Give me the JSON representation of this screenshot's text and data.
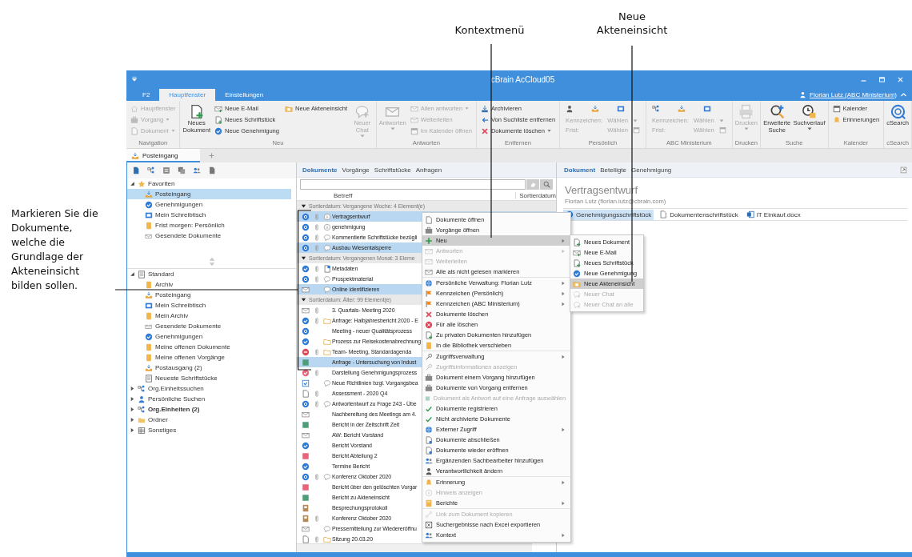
{
  "callouts": [
    {
      "text": "Kontextmenü"
    },
    {
      "text": "Neue Akteneinsicht"
    }
  ],
  "instruction": "Markieren Sie die Dokumente, welche die Grundlage der Akteneinsicht bilden sollen.",
  "window": {
    "title": "cBrain AcCloud05",
    "user": "Florian Lutz (ABC Ministerium)"
  },
  "ribbon_tabs": [
    {
      "label": "F2",
      "selected": false
    },
    {
      "label": "Hauptfenster",
      "selected": true
    },
    {
      "label": "Einstellungen",
      "selected": false
    }
  ],
  "ribbon_groups": [
    {
      "label": "Navigation",
      "columns": [
        [
          {
            "kind": "small",
            "label": "Hauptfenster",
            "disabled": true,
            "dropdown": false
          },
          {
            "kind": "small",
            "label": "Vorgang",
            "disabled": true,
            "dropdown": true
          },
          {
            "kind": "small",
            "label": "Dokument",
            "disabled": true,
            "dropdown": true
          }
        ]
      ]
    },
    {
      "label": "Neu",
      "columns": [
        [
          {
            "kind": "large",
            "label": "Neues Dokument",
            "disabled": false,
            "dropdown": false
          }
        ],
        [
          {
            "kind": "small",
            "label": "Neue E-Mail",
            "disabled": false,
            "dropdown": false
          },
          {
            "kind": "small",
            "label": "Neues Schriftstück",
            "disabled": false,
            "dropdown": false
          },
          {
            "kind": "small",
            "label": "Neue Genehmigung",
            "disabled": false,
            "dropdown": false
          }
        ],
        [
          {
            "kind": "small",
            "label": "Neue Akteneinsicht",
            "disabled": false,
            "dropdown": false
          }
        ],
        [
          {
            "kind": "large",
            "label": "Neuer Chat",
            "disabled": true,
            "dropdown": true
          }
        ]
      ]
    },
    {
      "label": "Antworten",
      "columns": [
        [
          {
            "kind": "large",
            "label": "Antworten",
            "disabled": true,
            "dropdown": true
          }
        ],
        [
          {
            "kind": "small",
            "label": "Allen antworten",
            "disabled": true,
            "dropdown": true
          },
          {
            "kind": "small",
            "label": "Weiterleiten",
            "disabled": true,
            "dropdown": false
          },
          {
            "kind": "small",
            "label": "Im Kalender öffnen",
            "disabled": true,
            "dropdown": false
          }
        ]
      ]
    },
    {
      "label": "Entfernen",
      "columns": [
        [
          {
            "kind": "small",
            "label": "Archivieren",
            "disabled": false,
            "dropdown": false
          },
          {
            "kind": "small",
            "label": "Von Suchliste entfernen",
            "disabled": false,
            "dropdown": false
          },
          {
            "kind": "small",
            "label": "Dokumente löschen",
            "disabled": false,
            "dropdown": true
          }
        ]
      ]
    },
    {
      "label": "Persönlich",
      "columns": [
        [
          {
            "kind": "field",
            "label": "Kennzeichen:",
            "value": "Wählen",
            "disabled": true,
            "dropdown": true
          },
          {
            "kind": "field",
            "label": "Frist:",
            "value": "Wählen",
            "disabled": true,
            "dropdown": false
          }
        ]
      ]
    },
    {
      "label": "ABC Ministerium",
      "columns": [
        [
          {
            "kind": "field",
            "label": "Kennzeichen:",
            "value": "Wählen",
            "disabled": true,
            "dropdown": true
          },
          {
            "kind": "field",
            "label": "Frist:",
            "value": "Wählen",
            "disabled": true,
            "dropdown": false
          }
        ]
      ]
    },
    {
      "label": "Drucken",
      "columns": [
        [
          {
            "kind": "large",
            "label": "Drucken",
            "disabled": true,
            "dropdown": true
          }
        ]
      ]
    },
    {
      "label": "Suche",
      "columns": [
        [
          {
            "kind": "large",
            "label": "Erweiterte Suche",
            "disabled": false,
            "dropdown": false
          }
        ],
        [
          {
            "kind": "large",
            "label": "Suchverlauf",
            "disabled": false,
            "dropdown": true
          }
        ]
      ]
    },
    {
      "label": "Kalender",
      "columns": [
        [
          {
            "kind": "small",
            "label": "Kalender",
            "disabled": false,
            "dropdown": false
          },
          {
            "kind": "small",
            "label": "Erinnerungen",
            "disabled": false,
            "dropdown": false
          }
        ]
      ]
    },
    {
      "label": "cSearch",
      "columns": [
        [
          {
            "kind": "large",
            "label": "cSearch",
            "disabled": false,
            "dropdown": false
          }
        ]
      ]
    }
  ],
  "document_tabs": [
    {
      "label": "Posteingang",
      "selected": true
    }
  ],
  "sidebar": {
    "favorites": {
      "label": "Favoriten",
      "expanded": true,
      "children": [
        {
          "label": "Posteingang",
          "selected": true
        },
        {
          "label": "Genehmigungen",
          "selected": false
        },
        {
          "label": "Mein Schreibtisch",
          "selected": false
        },
        {
          "label": "Frist morgen: Persönlich",
          "selected": false
        },
        {
          "label": "Gesendete Dokumente",
          "selected": false
        }
      ]
    },
    "tree": [
      {
        "label": "Standard",
        "expanded": true,
        "unread": false,
        "children": [
          {
            "label": "Archiv",
            "selected": false
          },
          {
            "label": "Posteingang",
            "selected": false
          },
          {
            "label": "Mein Schreibtisch",
            "selected": false
          },
          {
            "label": "Mein Archiv",
            "selected": false
          },
          {
            "label": "Gesendete Dokumente",
            "selected": false
          },
          {
            "label": "Genehmigungen",
            "selected": false
          },
          {
            "label": "Meine offenen Dokumente",
            "selected": false
          },
          {
            "label": "Meine offenen Vorgänge",
            "selected": false
          },
          {
            "label": "Postausgang (2)",
            "selected": false
          },
          {
            "label": "Neueste Schriftstücke",
            "selected": false
          }
        ]
      },
      {
        "label": "Org.Einheitssuchen",
        "expanded": false,
        "unread": false
      },
      {
        "label": "Persönliche Suchen",
        "expanded": false,
        "unread": false
      },
      {
        "label": "Org.Einheiten (2)",
        "expanded": false,
        "unread": true
      },
      {
        "label": "Ordner",
        "expanded": false,
        "unread": false
      },
      {
        "label": "Sonstiges",
        "expanded": false,
        "unread": false
      }
    ]
  },
  "document_list": {
    "tabs": [
      {
        "label": "Dokumente",
        "selected": true
      },
      {
        "label": "Vorgänge",
        "selected": false
      },
      {
        "label": "Schriftstücke",
        "selected": false
      },
      {
        "label": "Anfragen",
        "selected": false
      }
    ],
    "columns": [
      "Betreff",
      "Sortierdatum"
    ],
    "groups": [
      {
        "label": "Sortierdatum: Vergangene Woche: 4 Element(e)",
        "expanded": true,
        "rows": [
          {
            "subject": "Vertragsentwurf",
            "kind": "badge",
            "attachment": true,
            "marker": {
              "kind": "info"
            },
            "selected": true
          },
          {
            "subject": "genehmigung",
            "kind": "badge",
            "attachment": true,
            "marker": {
              "kind": "info"
            },
            "selected": false
          },
          {
            "subject": "Kommentierte Schriftstücke bezügli",
            "kind": "badge",
            "attachment": true,
            "marker": {
              "kind": "comment"
            },
            "selected": false
          },
          {
            "subject": "Ausbau Wiesentalsperre",
            "kind": "badge",
            "attachment": true,
            "marker": {
              "kind": "comment"
            },
            "selected": true
          }
        ]
      },
      {
        "label": "Sortierdatum: Vergangenen Monat: 3 Eleme",
        "expanded": true,
        "rows": [
          {
            "subject": "Metadaten",
            "kind": "check",
            "attachment": true,
            "marker": {
              "kind": "meta"
            },
            "selected": false
          },
          {
            "subject": "Prospektmaterial",
            "kind": "badge",
            "attachment": true,
            "marker": {
              "kind": "comment"
            },
            "selected": false
          },
          {
            "subject": "Online identifizieren",
            "kind": "mail",
            "attachment": false,
            "marker": {
              "kind": "comment"
            },
            "selected": true
          }
        ]
      },
      {
        "label": "Sortierdatum: Älter: 99 Element(e)",
        "expanded": true,
        "rows": [
          {
            "subject": "3. Quartals- Meeting 2020",
            "kind": "mail",
            "attachment": true,
            "selected": false
          },
          {
            "subject": "Anfrage: Halbjahresbericht 2020 - E",
            "kind": "check",
            "attachment": true,
            "marker": {
              "kind": "folder"
            },
            "selected": false
          },
          {
            "subject": "Meeting - neuer Qualitätsprozess",
            "kind": "badge",
            "attachment": false,
            "selected": false
          },
          {
            "subject": "Prozess zur Reisekostenabrechnung",
            "kind": "check",
            "attachment": false,
            "marker": {
              "kind": "folder"
            },
            "selected": false
          },
          {
            "subject": "Team- Meeting, Standardagenda",
            "kind": "stop",
            "attachment": true,
            "marker": {
              "kind": "folder"
            },
            "selected": false
          },
          {
            "subject": "Anfrage - Untersuchung von Indust",
            "kind": "green",
            "attachment": false,
            "selected": true
          },
          {
            "subject": "Darstellung Genehmigungsprozess",
            "kind": "redcheck",
            "attachment": true,
            "selected": false
          },
          {
            "subject": "Neue Richtlinien bzgl. Vorgangsbea",
            "kind": "checkbox",
            "attachment": false,
            "marker": {
              "kind": "comment"
            },
            "selected": false
          },
          {
            "subject": "Assessment - 2020 Q4",
            "kind": "doc",
            "attachment": true,
            "selected": false
          },
          {
            "subject": "Antwortentwurf zu Frage 243 - Übe",
            "kind": "badge",
            "attachment": true,
            "marker": {
              "kind": "comment"
            },
            "selected": false
          },
          {
            "subject": "Nachbereitung des Meetings am 4.",
            "kind": "mail",
            "attachment": false,
            "selected": false
          },
          {
            "subject": "Bericht in der Zeitschrift Zeit",
            "kind": "green",
            "attachment": false,
            "selected": false
          },
          {
            "subject": "AW: Bericht Vorstand",
            "kind": "mail",
            "attachment": false,
            "selected": false
          },
          {
            "subject": "Bericht Vorstand",
            "kind": "check",
            "attachment": false,
            "selected": false
          },
          {
            "subject": "Bericht Abteilung 2",
            "kind": "red",
            "attachment": false,
            "selected": false
          },
          {
            "subject": "Termine Bericht",
            "kind": "check",
            "attachment": false,
            "selected": false
          },
          {
            "subject": "Konferenz Oktober 2020",
            "kind": "badge",
            "attachment": true,
            "marker": {
              "kind": "comment"
            },
            "selected": false
          },
          {
            "subject": "Bericht über den gelöschten Vorgar",
            "kind": "red",
            "attachment": false,
            "selected": false
          },
          {
            "subject": "Bericht zu Akteneinsicht",
            "kind": "green",
            "attachment": false,
            "selected": false
          },
          {
            "subject": "Besprechungsprotokoll",
            "kind": "brown",
            "attachment": false,
            "selected": false
          },
          {
            "subject": "Konferenz Oktober 2020",
            "kind": "brown",
            "attachment": true,
            "selected": false
          },
          {
            "subject": "Pressemitteilung zur Wiedereröffnu",
            "kind": "mail",
            "attachment": false,
            "marker": {
              "kind": "comment"
            },
            "selected": false
          },
          {
            "subject": "Sitzung 20.03.20",
            "kind": "doc",
            "attachment": true,
            "marker": {
              "kind": "folder"
            },
            "selected": false
          }
        ]
      }
    ]
  },
  "context_menu": {
    "sections": [
      [
        {
          "label": "Dokumente öffnen",
          "disabled": false,
          "submenu": false,
          "selected": false
        },
        {
          "label": "Vorgänge öffnen",
          "disabled": false,
          "submenu": false,
          "selected": false
        },
        {
          "label": "Neu",
          "disabled": false,
          "submenu": true,
          "selected": true
        },
        {
          "label": "Antworten",
          "disabled": true,
          "submenu": true,
          "selected": false
        },
        {
          "label": "Weiterleiten",
          "disabled": true,
          "submenu": false,
          "selected": false
        },
        {
          "label": "Alle als nicht gelesen markieren",
          "disabled": false,
          "submenu": false,
          "selected": false
        }
      ],
      [
        {
          "label": "Persönliche Verwaltung: Florian Lutz",
          "disabled": false,
          "submenu": true,
          "selected": false
        },
        {
          "label": "Kennzeichen (Persönlich)",
          "disabled": false,
          "submenu": true,
          "selected": false
        },
        {
          "label": "Kennzeichen (ABC Ministerium)",
          "disabled": false,
          "submenu": true,
          "selected": false
        },
        {
          "label": "Dokumente löschen",
          "disabled": false,
          "submenu": false,
          "selected": false
        },
        {
          "label": "Für alle löschen",
          "disabled": false,
          "submenu": false,
          "selected": false
        },
        {
          "label": "Zu privaten Dokumenten hinzufügen",
          "disabled": false,
          "submenu": false,
          "selected": false
        },
        {
          "label": "In die Bibliothek verschieben",
          "disabled": false,
          "submenu": false,
          "selected": false
        }
      ],
      [
        {
          "label": "Zugriffsverwaltung",
          "disabled": false,
          "submenu": true,
          "selected": false
        },
        {
          "label": "Zugriffsinformationen anzeigen",
          "disabled": true,
          "submenu": false,
          "selected": false
        },
        {
          "label": "Dokument einem Vorgang hinzufügen",
          "disabled": false,
          "submenu": false,
          "selected": false
        },
        {
          "label": "Dokumente von Vorgang entfernen",
          "disabled": false,
          "submenu": false,
          "selected": false
        },
        {
          "label": "Dokument als Antwort auf eine Anfrage auswählen",
          "disabled": true,
          "submenu": false,
          "selected": false
        },
        {
          "label": "Dokumente registrieren",
          "disabled": false,
          "submenu": false,
          "selected": false
        },
        {
          "label": "Nicht archivierte Dokumente",
          "disabled": false,
          "submenu": false,
          "selected": false
        },
        {
          "label": "Externer Zugriff",
          "disabled": false,
          "submenu": true,
          "selected": false
        },
        {
          "label": "Dokumente abschließen",
          "disabled": false,
          "submenu": false,
          "selected": false
        },
        {
          "label": "Dokumente wieder eröffnen",
          "disabled": false,
          "submenu": false,
          "selected": false
        },
        {
          "label": "Ergänzenden Sachbearbeiter hinzufügen",
          "disabled": false,
          "submenu": false,
          "selected": false
        },
        {
          "label": "Verantwortlichkeit ändern",
          "disabled": false,
          "submenu": false,
          "selected": false
        }
      ],
      [
        {
          "label": "Erinnerung",
          "disabled": false,
          "submenu": true,
          "selected": false
        },
        {
          "label": "Hinweis anzeigen",
          "disabled": true,
          "submenu": false,
          "selected": false
        },
        {
          "label": "Berichte",
          "disabled": false,
          "submenu": true,
          "selected": false
        }
      ],
      [
        {
          "label": "Link zum Dokument kopieren",
          "disabled": true,
          "submenu": false,
          "selected": false
        },
        {
          "label": "Suchergebnisse nach Excel exportieren",
          "disabled": false,
          "submenu": false,
          "selected": false
        },
        {
          "label": "Kontext",
          "disabled": false,
          "submenu": true,
          "selected": false
        }
      ]
    ]
  },
  "submenu": {
    "items": [
      {
        "label": "Neues Dokument",
        "disabled": false,
        "selected": false
      },
      {
        "label": "Neue E-Mail",
        "disabled": false,
        "selected": false
      },
      {
        "label": "Neues Schriftstück",
        "disabled": false,
        "selected": false
      },
      {
        "label": "Neue Genehmigung",
        "disabled": false,
        "selected": false
      },
      {
        "label": "Neue Akteneinsicht",
        "disabled": false,
        "selected": true
      },
      {
        "label": "Neuer Chat",
        "disabled": true,
        "selected": false
      },
      {
        "label": "Neuer Chat an alle",
        "disabled": true,
        "selected": false
      }
    ]
  },
  "preview": {
    "tabs": [
      {
        "label": "Dokument",
        "selected": true
      },
      {
        "label": "Beteiligte",
        "selected": false
      },
      {
        "label": "Genehmigung",
        "selected": false
      }
    ],
    "title": "Vertragsentwurf",
    "sender": "Florian Lutz (florian.lutz@cbrain.com)",
    "attachments": [
      {
        "label": "Genehmigungsschriftstück",
        "selected": true
      },
      {
        "label": "Dokumentenschriftstück",
        "selected": false
      },
      {
        "label": "IT Einkauf.docx",
        "selected": false
      }
    ]
  }
}
